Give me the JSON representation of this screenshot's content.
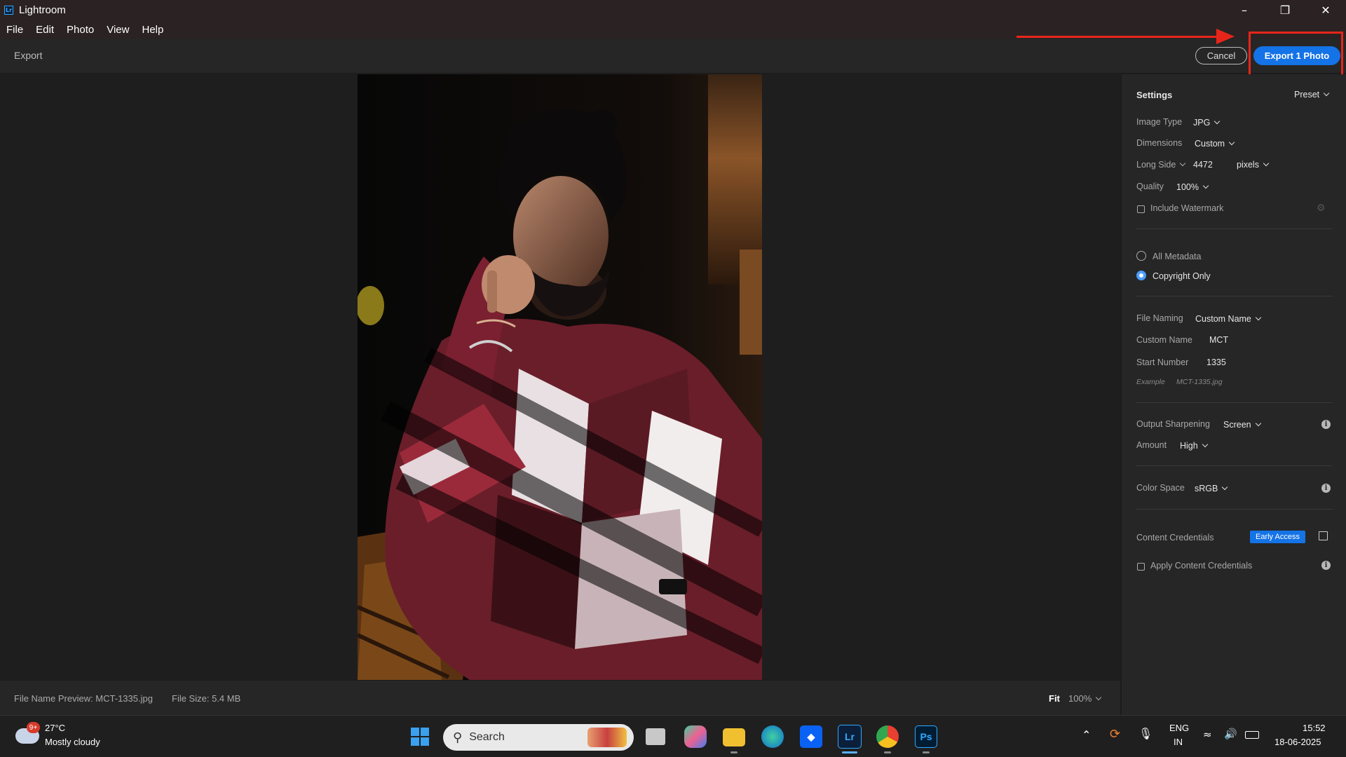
{
  "window": {
    "logo": "Lr",
    "title": "Lightroom",
    "minimize_icon": "minimize-icon",
    "restore_icon": "restore-icon",
    "close_icon": "close-icon"
  },
  "menu": [
    "File",
    "Edit",
    "Photo",
    "View",
    "Help"
  ],
  "toolbar": {
    "title": "Export",
    "cancel_label": "Cancel",
    "export_label": "Export 1 Photo"
  },
  "annotation": {
    "color": "#e8251a"
  },
  "status": {
    "file_name_preview": "File Name Preview: MCT-1335.jpg",
    "file_size": "File Size: 5.4 MB",
    "fit_label": "Fit",
    "zoom": "100%"
  },
  "settings": {
    "header": "Settings",
    "preset_label": "Preset",
    "image_type_label": "Image Type",
    "image_type_value": "JPG",
    "dimensions_label": "Dimensions",
    "dimensions_value": "Custom",
    "long_side_label": "Long Side",
    "long_side_value": "4472",
    "unit_value": "pixels",
    "quality_label": "Quality",
    "quality_value": "100%",
    "watermark_label": "Include Watermark",
    "watermark_checked": false,
    "metadata_all_label": "All Metadata",
    "metadata_copyright_label": "Copyright Only",
    "metadata_selected": "Copyright Only",
    "file_naming_label": "File Naming",
    "file_naming_value": "Custom Name",
    "custom_name_label": "Custom Name",
    "custom_name_value": "MCT",
    "start_number_label": "Start Number",
    "start_number_value": "1335",
    "example_label": "Example",
    "example_value": "MCT-1335.jpg",
    "sharpening_label": "Output Sharpening",
    "sharpening_value": "Screen",
    "amount_label": "Amount",
    "amount_value": "High",
    "color_space_label": "Color Space",
    "color_space_value": "sRGB",
    "content_credentials_label": "Content Credentials",
    "early_access_badge": "Early Access",
    "apply_credentials_label": "Apply Content Credentials",
    "apply_credentials_checked": false,
    "accent_color": "#1473e6"
  },
  "taskbar": {
    "weather_badge": "9+",
    "weather_temp": "27°C",
    "weather_desc": "Mostly cloudy",
    "search_placeholder": "Search",
    "apps": [
      "start-icon",
      "task-view-icon",
      "copilot-icon",
      "file-explorer-icon",
      "edge-icon",
      "dropbox-icon",
      "lightroom-icon",
      "chrome-icon",
      "photoshop-icon"
    ],
    "lr_label": "Lr",
    "ps_label": "Ps",
    "lang_top": "ENG",
    "lang_bottom": "IN",
    "time": "15:52",
    "date": "18-06-2025"
  }
}
